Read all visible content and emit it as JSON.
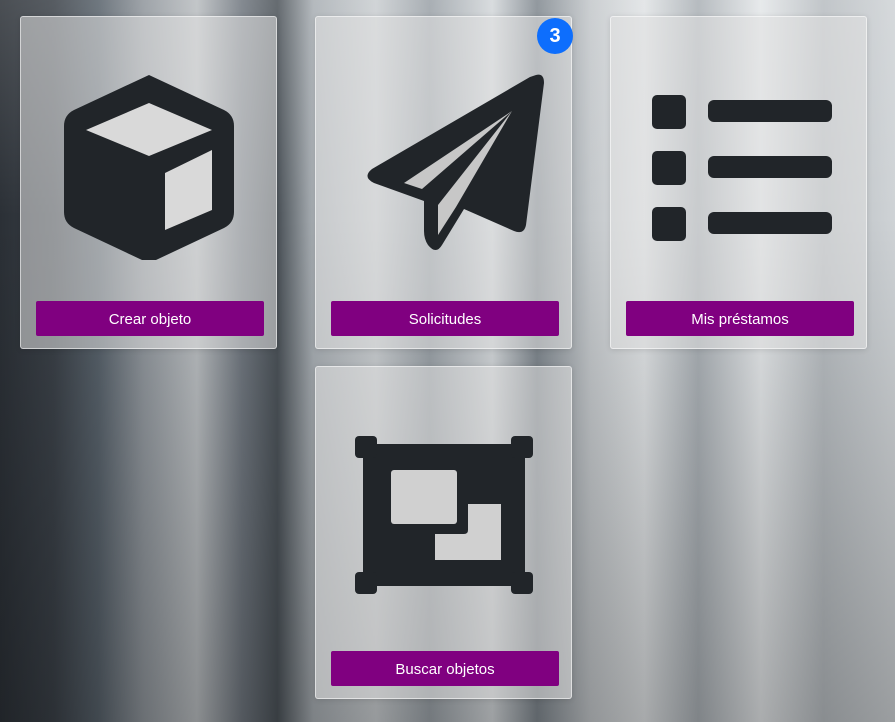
{
  "colors": {
    "button_bg": "#800080",
    "button_text": "#ffffff",
    "icon": "#212529",
    "badge_bg": "#0d6efd"
  },
  "cards": [
    {
      "icon": "box-icon",
      "label": "Crear objeto"
    },
    {
      "icon": "paper-plane-icon",
      "label": "Solicitudes",
      "badge": "3"
    },
    {
      "icon": "list-icon",
      "label": "Mis préstamos"
    },
    {
      "icon": "search-objects-icon",
      "label": "Buscar objetos"
    }
  ]
}
